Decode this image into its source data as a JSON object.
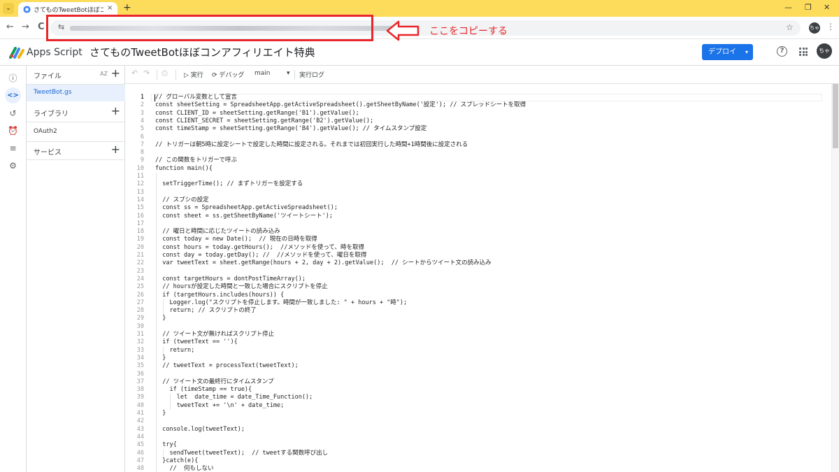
{
  "browser": {
    "tab_title": "さてものTweetBotほぼコンアフィリエイト特典",
    "tab_close": "×",
    "new_tab": "+",
    "tab_menu": "⌄",
    "back": "←",
    "forward": "→",
    "reload": "C",
    "site_info": "⇆",
    "bookmark": "☆",
    "avatar": "ちゃ",
    "menu": "⋮",
    "minimize": "—",
    "restore": "❐",
    "close": "✕"
  },
  "annotation": {
    "callout": "ここをコピーする",
    "color": "#e8262b"
  },
  "header": {
    "brand": "Apps Script",
    "project_title": "さてものTweetBotほぼコンアフィリエイト特典",
    "deploy_label": "デプロイ",
    "deploy_caret": "▾",
    "help": "?",
    "avatar": "ちゃ",
    "accent": "#1a73e8"
  },
  "rail": {
    "icons": [
      "info-icon",
      "code-icon",
      "history-icon",
      "clock-trigger-icon",
      "executions-icon",
      "settings-icon"
    ],
    "info": "ⓘ",
    "code": "<>",
    "history": "↺",
    "clock": "⏰",
    "executions": "≡",
    "settings": "⚙"
  },
  "files": {
    "files_label": "ファイル",
    "sort": "AZ",
    "plus": "+",
    "active_file": "TweetBot.gs",
    "libraries_label": "ライブラリ",
    "library_item": "OAuth2",
    "services_label": "サービス"
  },
  "editor_toolbar": {
    "undo": "↶",
    "redo": "↷",
    "save": "⎙",
    "run": "▷ 実行",
    "debug": "⟳ デバッグ",
    "function_name": "main",
    "function_caret": "▾",
    "exec_log": "実行ログ"
  },
  "code_lines": [
    "// グローバル変数として宣言",
    "const sheetSetting = SpreadsheetApp.getActiveSpreadsheet().getSheetByName('設定'); // スプレッドシートを取得",
    "const CLIENT_ID = sheetSetting.getRange('B1').getValue();",
    "const CLIENT_SECRET = sheetSetting.getRange('B2').getValue();",
    "const timeStamp = sheetSetting.getRange('B4').getValue(); // タイムスタンプ設定",
    "",
    "// トリガーは朝5時に設定シートで設定した時間に設定される。それまでは初回実行した時間+1時間後に設定される",
    "",
    "// この関数をトリガーで呼ぶ",
    "function main(){",
    "",
    "  setTriggerTime(); // まずトリガーを設定する",
    "",
    "  // スプシの設定",
    "  const ss = SpreadsheetApp.getActiveSpreadsheet();",
    "  const sheet = ss.getSheetByName('ツイートシート');",
    "",
    "  // 曜日と時間に応じたツイートの読み込み",
    "  const today = new Date();  // 現在の日時を取得",
    "  const hours = today.getHours();  //メソッドを使って、時を取得",
    "  const day = today.getDay(); //  //メソッドを使って、曜日を取得",
    "  var tweetText = sheet.getRange(hours + 2, day + 2).getValue();  // シートからツイート文の読み込み",
    "",
    "  const targetHours = dontPostTimeArray();",
    "  // hoursが設定した時間と一致した場合にスクリプトを停止",
    "  if (targetHours.includes(hours)) {",
    "    Logger.log(\"スクリプトを停止します。時間が一致しました: \" + hours + \"時\");",
    "    return; // スクリプトの終了",
    "  }",
    "",
    "  // ツイート文が無ければスクリプト停止",
    "  if (tweetText == ''){",
    "    return;",
    "  }",
    "  // tweetText = processText(tweetText);",
    "",
    "  // ツイート文の最終行にタイムスタンプ",
    "    if (timeStamp == true){",
    "      let  date_time = date_Time_Function();",
    "      tweetText += '\\n' + date_time;",
    "  }",
    "",
    "  console.log(tweetText);",
    "",
    "  try{",
    "    sendTweet(tweetText);  // tweetする関数呼び出し",
    "  }catch(e){",
    "    //  何もしない"
  ]
}
